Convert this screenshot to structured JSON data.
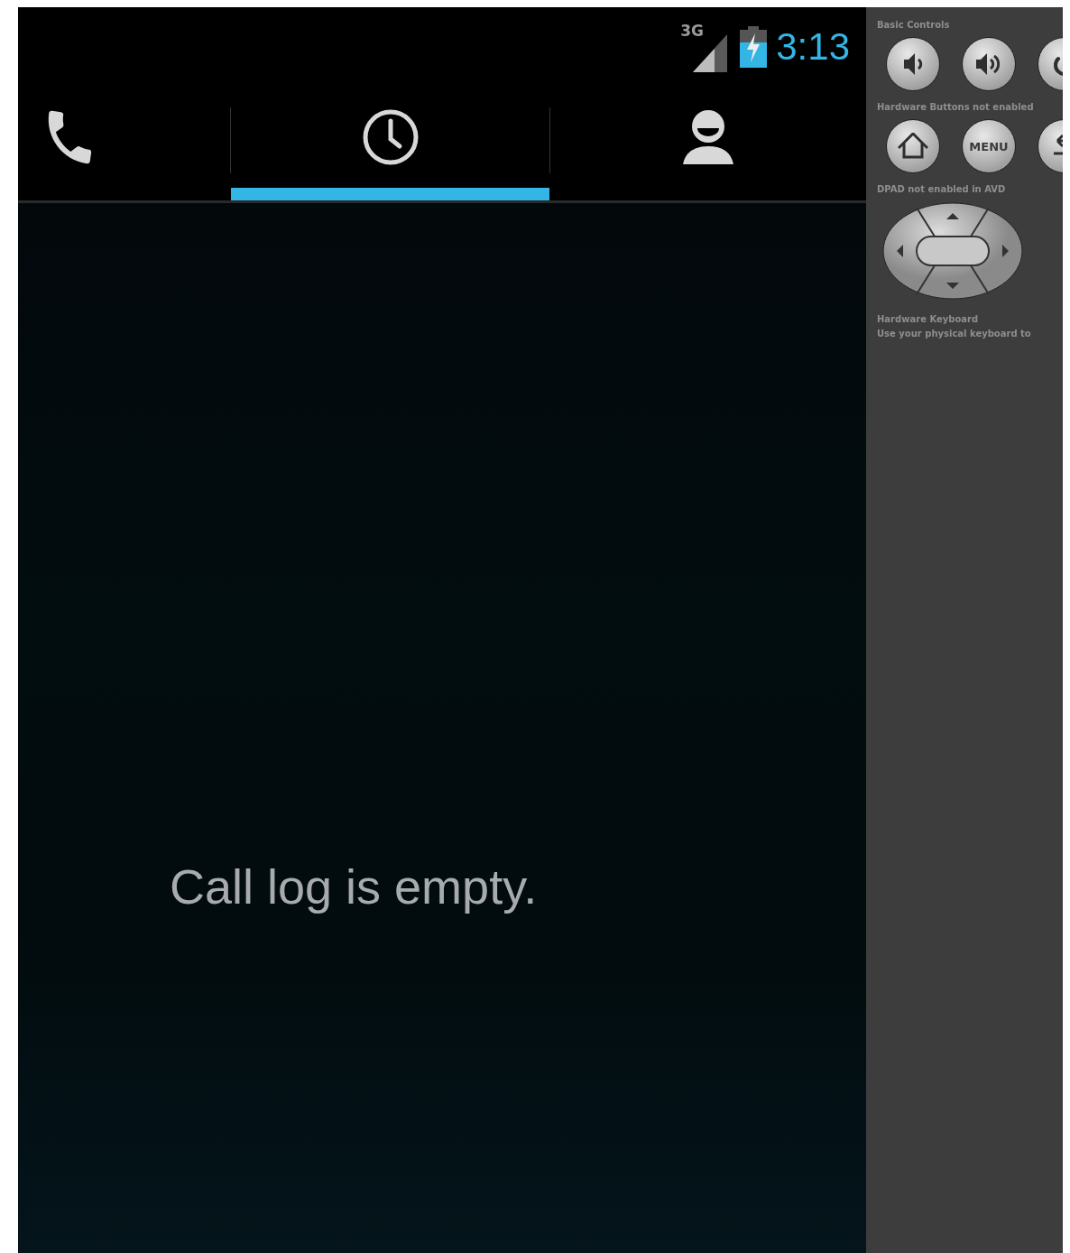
{
  "status_bar": {
    "network": "3G",
    "time": "3:13"
  },
  "tabs": [
    {
      "kind": "phone",
      "selected": false
    },
    {
      "kind": "call-log",
      "selected": true
    },
    {
      "kind": "contacts",
      "selected": false
    }
  ],
  "empty_message": "Call log is empty.",
  "side_panel": {
    "sections": [
      {
        "title": "Basic Controls",
        "kind": "buttons",
        "buttons": [
          {
            "kind": "volume-down"
          },
          {
            "kind": "volume-up"
          },
          {
            "kind": "power"
          }
        ]
      },
      {
        "title": "Hardware Buttons not enabled",
        "kind": "buttons",
        "buttons": [
          {
            "kind": "home"
          },
          {
            "kind": "menu",
            "label": "MENU"
          },
          {
            "kind": "back"
          }
        ]
      },
      {
        "title": "DPAD not enabled in AVD",
        "kind": "dpad"
      },
      {
        "title": "Hardware Keyboard",
        "kind": "text"
      },
      {
        "title": "Use your physical keyboard to",
        "kind": "text"
      }
    ]
  }
}
